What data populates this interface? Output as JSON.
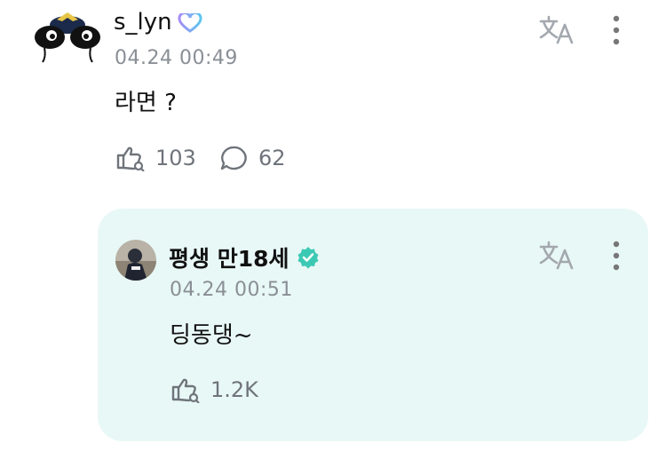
{
  "post": {
    "username": "s_lyn",
    "badge_icon": "fan-heart-badge-icon",
    "timestamp": "04.24 00:49",
    "text": "라면 ?",
    "likes": "103",
    "comments": "62"
  },
  "reply": {
    "username": "평생 만18세",
    "verified_icon": "verified-check-icon",
    "timestamp": "04.24 00:51",
    "text": "딩동댕~",
    "likes": "1.2K"
  },
  "colors": {
    "reply_background": "#e8f8f6",
    "muted_text": "#8a8f96",
    "icon_gray": "#6f747b",
    "translate_icon": "#a3a8ae",
    "verified_teal": "#3cc9b4",
    "badge_gradient_start": "#a58cf7",
    "badge_gradient_end": "#5cc7f0"
  }
}
